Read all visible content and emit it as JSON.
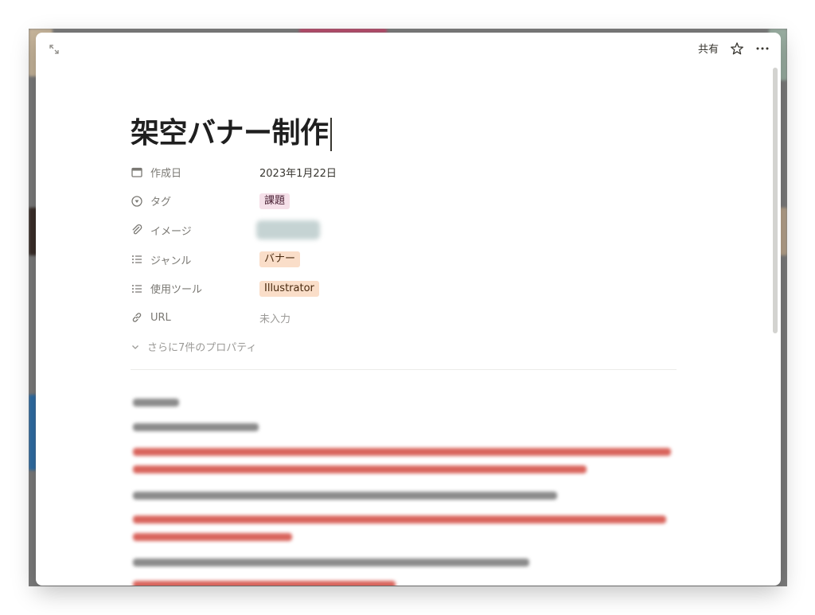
{
  "toolbar": {
    "share_label": "共有"
  },
  "page": {
    "title": "架空バナー制作"
  },
  "properties": [
    {
      "icon": "calendar-icon",
      "label": "作成日",
      "value": "2023年1月22日",
      "type": "date"
    },
    {
      "icon": "tag-icon",
      "label": "タグ",
      "value": "課題",
      "type": "tag",
      "color": "#f5e0e9"
    },
    {
      "icon": "paperclip-icon",
      "label": "イメージ",
      "value": "",
      "type": "image"
    },
    {
      "icon": "list-icon",
      "label": "ジャンル",
      "value": "バナー",
      "type": "tag",
      "color": "#fadec9"
    },
    {
      "icon": "list-icon",
      "label": "使用ツール",
      "value": "Illustrator",
      "type": "tag",
      "color": "#fadec9"
    },
    {
      "icon": "link-icon",
      "label": "URL",
      "value": "未入力",
      "type": "empty"
    }
  ],
  "more_properties_label": "さらに7件のプロパティ",
  "colors": {
    "accent_red": "#d9645c",
    "tag_pink": "#f5e0e9",
    "tag_orange": "#fadec9",
    "text_primary": "#37352f",
    "text_secondary": "#7a7873"
  }
}
